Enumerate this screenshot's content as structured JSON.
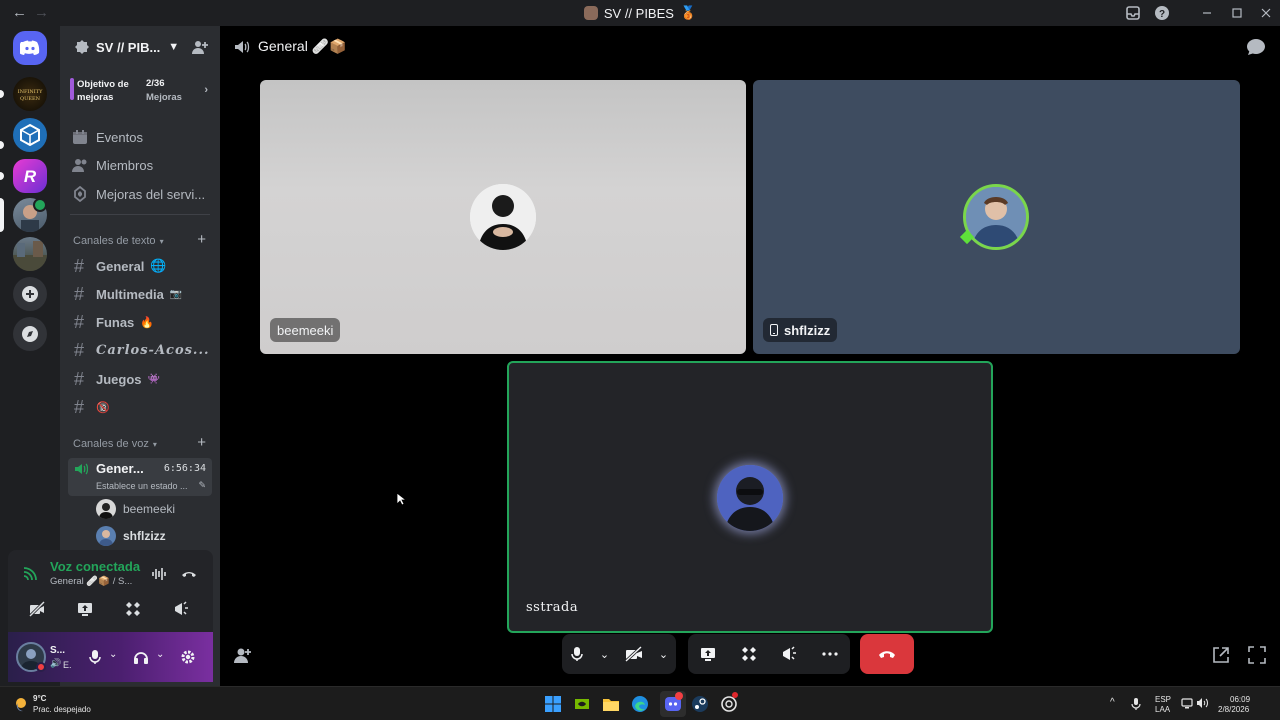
{
  "window": {
    "title": "SV // PIBES",
    "back": "←",
    "forward": "→"
  },
  "server": {
    "name": "SV // PIB...",
    "boost_goal_label": "Objetivo de mejoras",
    "boost_count": "2/36",
    "boost_unit": "Mejoras"
  },
  "nav": {
    "events": "Eventos",
    "members": "Miembros",
    "boosts": "Mejoras del servi..."
  },
  "text_category": "Canales de texto",
  "text_channels": [
    {
      "label": "General",
      "emoji": "🌐"
    },
    {
      "label": "Multimedia",
      "emoji": "📷"
    },
    {
      "label": "Funas",
      "emoji": "🔥"
    },
    {
      "label": "Carlos-Acos...",
      "emoji": ""
    },
    {
      "label": "Juegos",
      "emoji": "👾"
    },
    {
      "label": "",
      "emoji": "🔞"
    }
  ],
  "voice_category": "Canales de voz",
  "voice_channel": {
    "label": "Gener...",
    "timer": "6:56:34",
    "status": "Establece un estado ..."
  },
  "voice_members": [
    "beemeeki",
    "shflzizz"
  ],
  "voice_panel": {
    "status": "Voz conectada",
    "channel": "General 🩹📦 / S..."
  },
  "user_panel": {
    "name": "S...",
    "status": "E."
  },
  "stage": {
    "channel": "General 🩹📦",
    "tiles": [
      {
        "name": "beemeeki"
      },
      {
        "name": "shflzizz"
      },
      {
        "name": "sstrada"
      }
    ]
  },
  "taskbar": {
    "weather_temp": "9°C",
    "weather_desc": "Prac. despejado",
    "lang_1": "ESP",
    "lang_2": "LAA",
    "time": "06:09",
    "date": "2/8/2026"
  },
  "colors": {
    "accent_green": "#23a55a",
    "hangup_red": "#da373c",
    "discord_blurple": "#5865f2"
  }
}
